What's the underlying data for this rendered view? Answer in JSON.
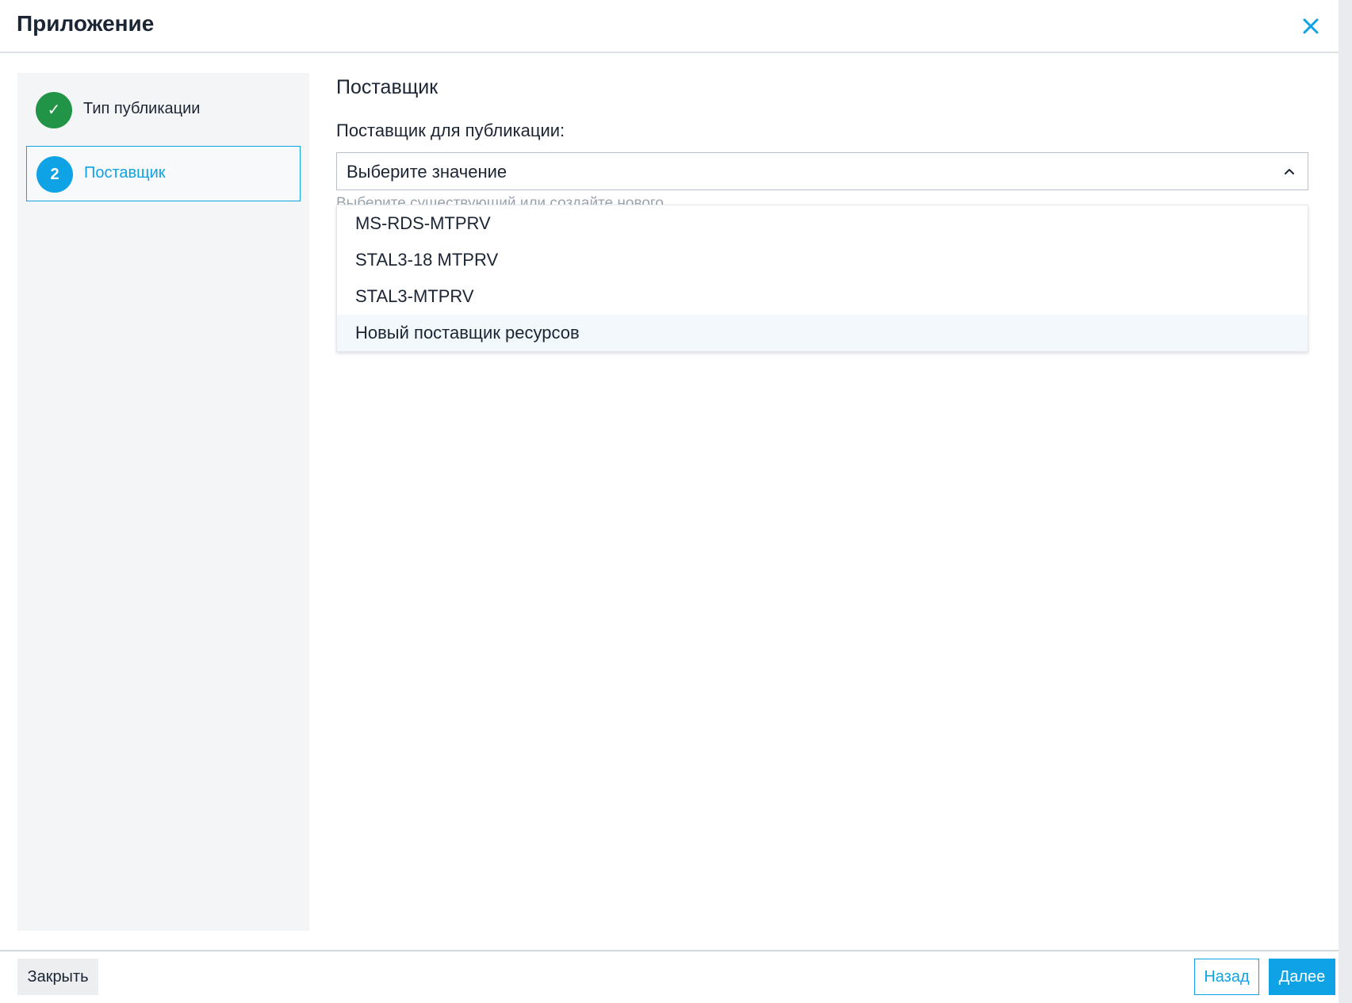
{
  "dialog": {
    "title": "Приложение",
    "close_icon": "close-icon",
    "accent_color": "#0fa3e6",
    "success_color": "#219447"
  },
  "steps": [
    {
      "marker": "✓",
      "label": "Тип публикации",
      "state": "done"
    },
    {
      "marker": "2",
      "label": "Поставщик",
      "state": "active"
    }
  ],
  "main": {
    "section_title": "Поставщик",
    "field_label": "Поставщик для публикации:",
    "select": {
      "value": "Выберите значение",
      "expanded": true,
      "icon": "chevron-up-icon"
    },
    "helper_text": "Выберите существующий или создайте нового",
    "options": [
      {
        "label": "MS-RDS-MTPRV"
      },
      {
        "label": "STAL3-18 MTPRV"
      },
      {
        "label": "STAL3-MTPRV"
      },
      {
        "label": "Новый поставщик ресурсов",
        "highlighted": true
      }
    ]
  },
  "footer": {
    "close_label": "Закрыть",
    "back_label": "Назад",
    "next_label": "Далее"
  }
}
